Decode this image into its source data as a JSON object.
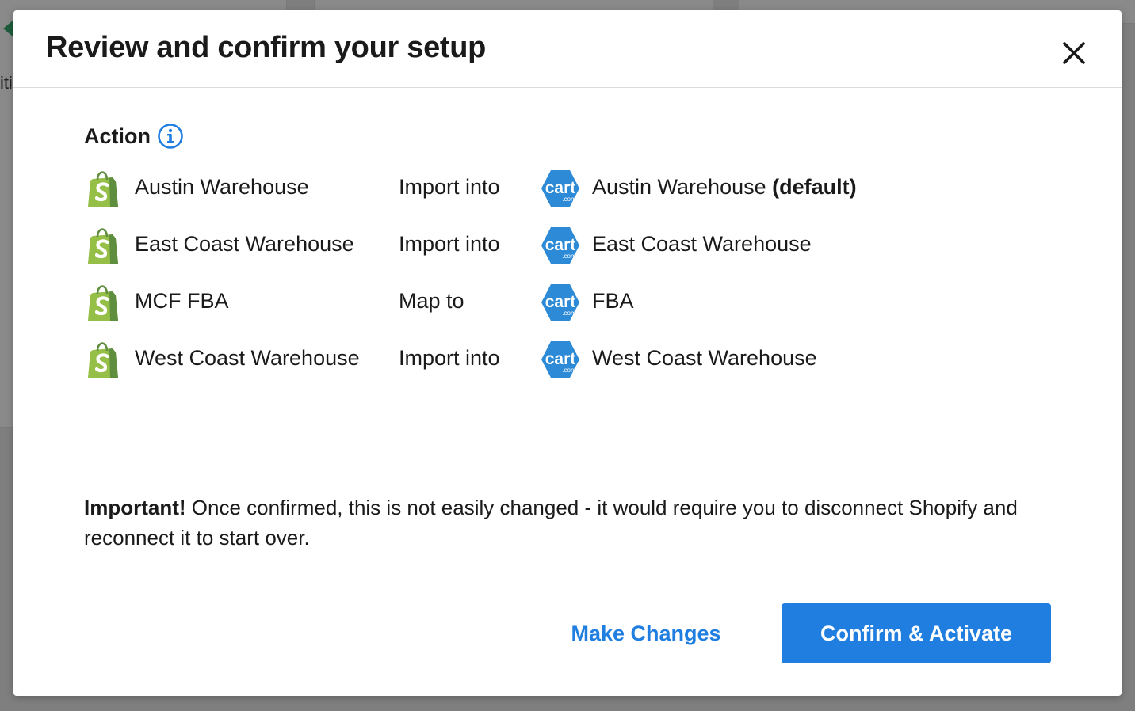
{
  "modal": {
    "title": "Review and confirm your setup",
    "close_icon": "close-icon"
  },
  "background": {
    "partial_text": "iti"
  },
  "action_section": {
    "title": "Action",
    "info_icon": "info-icon",
    "rows": [
      {
        "source_icon": "shopify-icon",
        "source": "Austin Warehouse",
        "verb": "Import into",
        "dest_icon": "cart-com-icon",
        "destination": "Austin Warehouse",
        "destination_suffix": "(default)"
      },
      {
        "source_icon": "shopify-icon",
        "source": "East Coast Warehouse",
        "verb": "Import into",
        "dest_icon": "cart-com-icon",
        "destination": "East Coast Warehouse",
        "destination_suffix": ""
      },
      {
        "source_icon": "shopify-icon",
        "source": "MCF FBA",
        "verb": "Map to",
        "dest_icon": "cart-com-icon",
        "destination": "FBA",
        "destination_suffix": ""
      },
      {
        "source_icon": "shopify-icon",
        "source": "West Coast Warehouse",
        "verb": "Import into",
        "dest_icon": "cart-com-icon",
        "destination": "West Coast Warehouse",
        "destination_suffix": ""
      }
    ]
  },
  "notice": {
    "emphasis": "Important!",
    "text": "Once confirmed, this is not easily changed - it would require you to disconnect Shopify and reconnect it to start over."
  },
  "footer": {
    "secondary_label": "Make Changes",
    "primary_label": "Confirm & Activate"
  },
  "colors": {
    "accent": "#1f7ee0",
    "shopify_green": "#95bf47",
    "cart_blue": "#2d8ad6"
  }
}
